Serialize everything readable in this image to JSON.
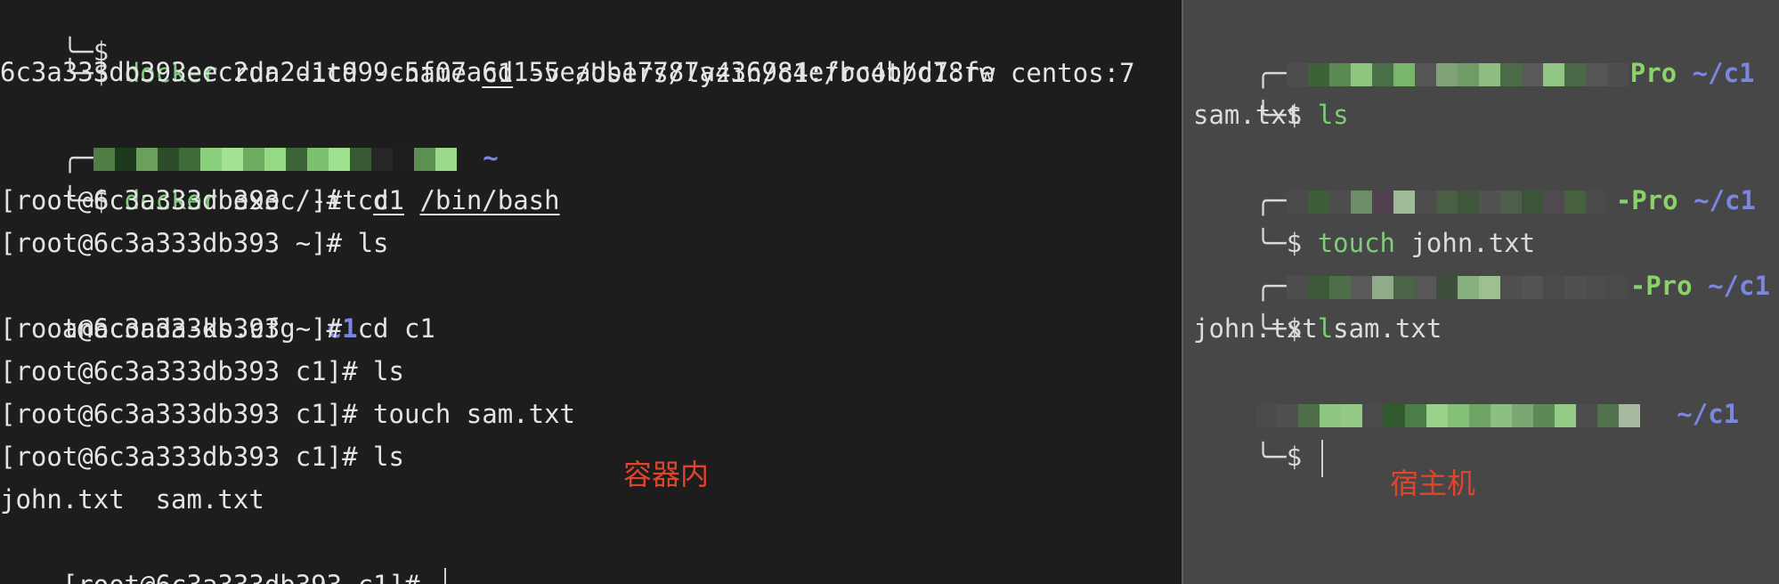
{
  "left": {
    "lines": {
      "cmd1_prefix": "╰─$ ",
      "cmd1_name": "docker",
      "cmd1_rest_a": " run -itd --name ",
      "cmd1_c1": "c1",
      "cmd1_rest_b": " -v /Users/lyzin/c1:/root/c1:rw centos:7",
      "container_id": "6c3a333db393eec2da2d1c999c5f07a6d155eadb17787a436984efbc4bbd78fe",
      "prompt2_open": "╭─",
      "prompt2_path": " ~",
      "cmd2_prefix": "╰─$ ",
      "cmd2_name": "docker",
      "cmd2_rest_a": " exec -it ",
      "cmd2_c1": "c1",
      "cmd2_space": " ",
      "cmd2_bin": "/bin/bash",
      "l1": "[root@6c3a333db393 /]# cd",
      "l2": "[root@6c3a333db393 ~]# ls",
      "l3_file": "anaconda-ks.cfg  ",
      "l3_dir": "c1",
      "l4": "[root@6c3a333db393 ~]# cd c1",
      "l5": "[root@6c3a333db393 c1]# ls",
      "l6": "[root@6c3a333db393 c1]# touch sam.txt",
      "l7": "[root@6c3a333db393 c1]# ls",
      "l8": "john.txt  sam.txt",
      "l9": "[root@6c3a333db393 c1]# "
    },
    "annotation": "容器内"
  },
  "right": {
    "host_suffix_1": "Pro",
    "host_suffix_2": "-Pro",
    "path": " ~/c1",
    "prompt_open": "╭─",
    "prompt_close": "╰─$ ",
    "cmd_ls": "ls",
    "out1": "sam.txt",
    "cmd_touch": "touch",
    "cmd_touch_arg": " john.txt",
    "out2": "john.txt sam.txt",
    "annotation": "宿主机"
  },
  "colors": {
    "terminal_left_bg": "#1d1d1d",
    "terminal_right_bg": "#474747",
    "command_green": "#7fcc7a",
    "directory_blue": "#7a86e0",
    "annotation_red": "#e0452b"
  }
}
